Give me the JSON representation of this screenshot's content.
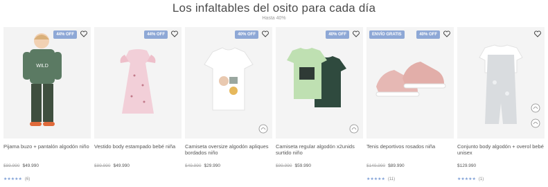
{
  "header": {
    "title": "Los infaltables del osito para cada día",
    "subtitle": "Hasta 40%"
  },
  "products": [
    {
      "badge": "44% OFF",
      "name": "Pijama buzo + pantalón algodón niño",
      "old_price": "$89.990",
      "price": "$49.990",
      "rating": "★★★★★",
      "reviews": "(6)"
    },
    {
      "badge": "44% OFF",
      "name": "Vestido body estampado bebé niña",
      "old_price": "$89.990",
      "price": "$49.990",
      "rating": "",
      "reviews": ""
    },
    {
      "badge": "40% OFF",
      "name": "Camiseta oversize algodón apliques bordados niño",
      "old_price": "$49.990",
      "price": "$29.990",
      "rating": "",
      "reviews": ""
    },
    {
      "badge": "40% OFF",
      "name": "Camiseta regular algodón x2unids surtido niño",
      "old_price": "$99.990",
      "price": "$59.990",
      "rating": "",
      "reviews": ""
    },
    {
      "badge": "ENVÍO GRATIS",
      "badge2": "40% OFF",
      "name": "Tenis deportivos rosados niña",
      "old_price": "$149.990",
      "price": "$89.990",
      "rating": "★★★★★",
      "reviews": "(11)"
    },
    {
      "badge": "",
      "name": "Conjunto body algodón + overol bebé unisex",
      "old_price": "",
      "price": "$129.990",
      "rating": "★★★★★",
      "reviews": "(1)"
    }
  ]
}
